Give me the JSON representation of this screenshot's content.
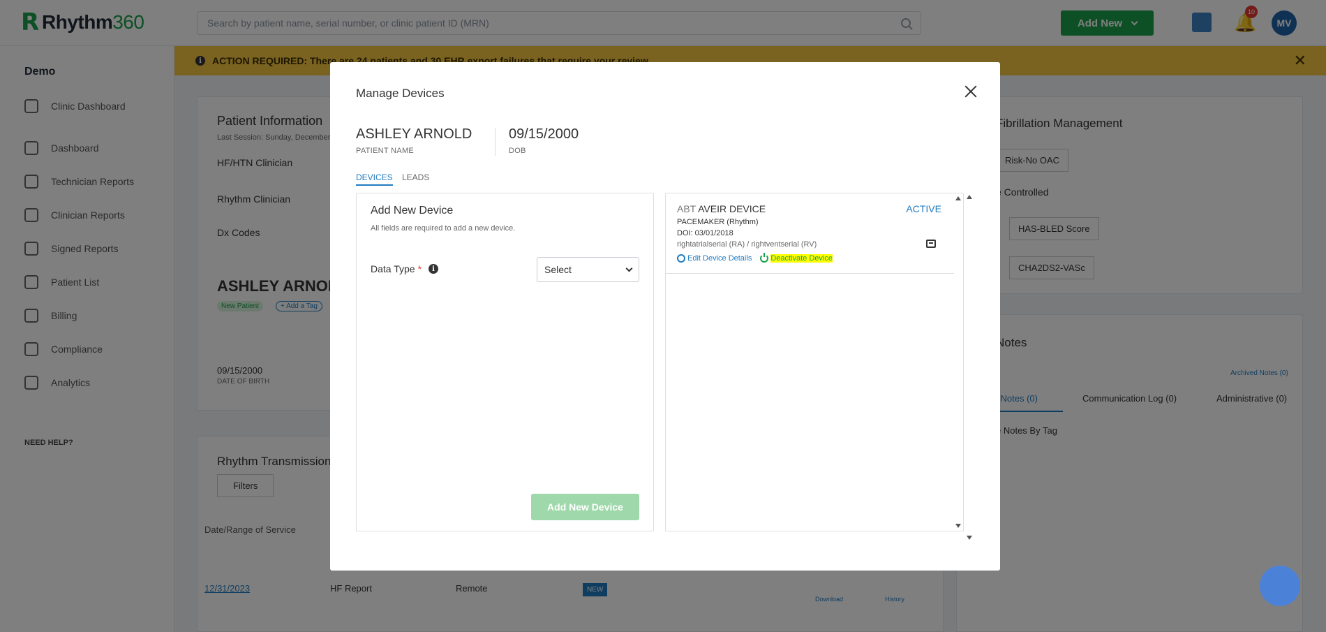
{
  "app": {
    "logo_mark": "R",
    "logo_text": "Rhythm",
    "logo_suffix": "360",
    "search_placeholder": "Search by patient name, serial number, or clinic patient ID (MRN)",
    "add_new_label": "Add New",
    "notification_count": "10",
    "user_initials": "MV",
    "brand_color": "#1aa04a",
    "accent_color": "#1f7bc1"
  },
  "sidebar": {
    "clinic": "Demo",
    "items": [
      {
        "label": "Clinic Dashboard",
        "icon": "home-icon"
      },
      {
        "label": "Dashboard",
        "icon": "dashboard-icon"
      },
      {
        "label": "Technician Reports",
        "icon": "report-icon"
      },
      {
        "label": "Clinician Reports",
        "icon": "clinician-icon"
      },
      {
        "label": "Signed Reports",
        "icon": "signed-icon"
      },
      {
        "label": "Patient List",
        "icon": "users-icon"
      },
      {
        "label": "Billing",
        "icon": "dollar-icon"
      },
      {
        "label": "Compliance",
        "icon": "warning-icon"
      },
      {
        "label": "Analytics",
        "icon": "analytics-icon"
      }
    ],
    "need_help": "NEED HELP?"
  },
  "action_bar": {
    "text": "ACTION REQUIRED: There are 24 patients and 30 EHR export failures that require your review."
  },
  "background": {
    "patient_info_title": "Patient Information",
    "last_session": "Last Session: Sunday, December",
    "hf_clinician": "HF/HTN Clinician",
    "rhythm_clinician": "Rhythm Clinician",
    "dx_codes": "Dx Codes",
    "patient_name": "ASHLEY ARNOLD",
    "new_patient_tag": "New Patient",
    "add_tag": "+ Add a Tag",
    "dob_value": "09/15/2000",
    "dob_label": "DATE OF BIRTH",
    "rhythm_transmissions": "Rhythm Transmissions",
    "filters": "Filters",
    "date_range": "Date/Range of Service",
    "row_date": "12/31/2023",
    "row_type": "HF Report",
    "row_remote": "Remote",
    "row_badge": "NEW",
    "download": "Download",
    "history": "History",
    "af_management": "Fibrillation Management",
    "risk_select": "Risk-No OAC",
    "rate_controlled": "e Controlled",
    "has_bled": "HAS-BLED Score",
    "cha2ds2": "CHA2DS2-VASc",
    "notes_title": "Notes",
    "archived_notes": "Archived Notes (0)",
    "clinical_notes_tab": "l Notes (0)",
    "comm_log_tab": "Communication Log (0)",
    "admin_tab": "Administrative (0)",
    "notes_by_tag": "e Notes By Tag"
  },
  "modal": {
    "title": "Manage Devices",
    "patient_name": "ASHLEY ARNOLD",
    "patient_name_label": "PATIENT NAME",
    "dob": "09/15/2000",
    "dob_label": "DOB",
    "tabs": [
      {
        "label": "DEVICES",
        "active": true
      },
      {
        "label": "LEADS",
        "active": false
      }
    ],
    "add_device": {
      "title": "Add New Device",
      "note": "All fields are required to add a new device.",
      "data_type_label": "Data Type",
      "required_mark": "*",
      "info_glyph": "i",
      "select_value": "Select",
      "button_label": "Add New Device"
    },
    "device": {
      "manufacturer": "ABT",
      "name": "AVEIR DEVICE",
      "status": "ACTIVE",
      "type": "PACEMAKER (Rhythm)",
      "doi": "DOI: 03/01/2018",
      "serials": "rightatrialserial (RA) / rightventserial (RV)",
      "edit_label": "Edit Device Details",
      "deactivate_label": "Deactivate Device"
    }
  }
}
